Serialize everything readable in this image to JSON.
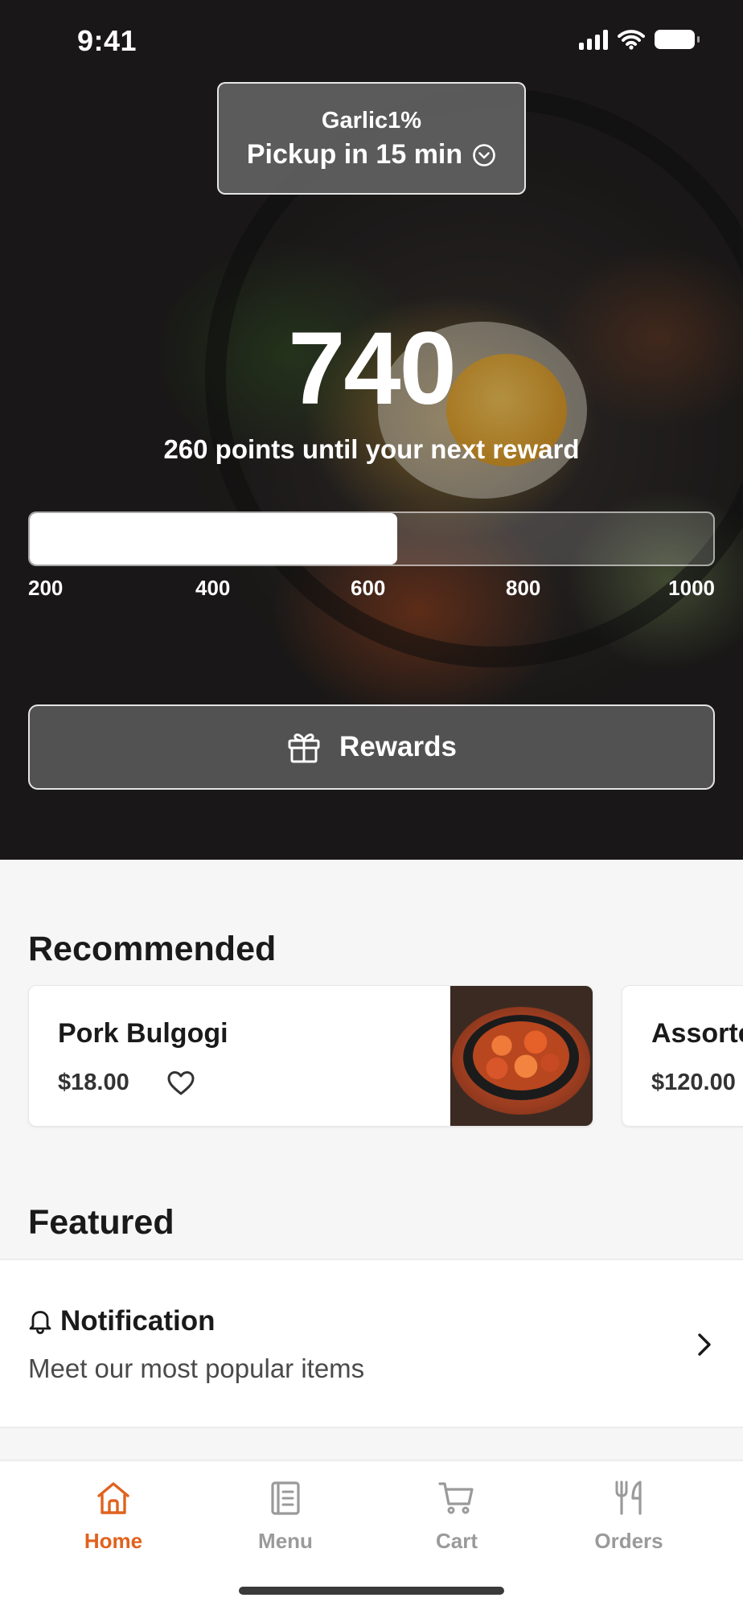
{
  "status_bar": {
    "time": "9:41"
  },
  "store": {
    "name": "Garlic1%",
    "pickup": "Pickup in 15 min"
  },
  "points": {
    "value": "740",
    "caption": "260 points until your next reward",
    "progress_fraction": 0.5375,
    "ticks": [
      "200",
      "400",
      "600",
      "800",
      "1000"
    ]
  },
  "rewards_button": {
    "label": "Rewards",
    "icon": "gift-icon"
  },
  "recommended": {
    "title": "Recommended",
    "items": [
      {
        "name": "Pork Bulgogi",
        "price": "$18.00",
        "favorite_icon": "heart-icon"
      },
      {
        "name": "Assorte",
        "price": "$120.00"
      }
    ]
  },
  "featured": {
    "title": "Featured",
    "notification": {
      "title": "Notification",
      "subtitle": "Meet our most popular items",
      "icon": "bell-icon"
    }
  },
  "tab_bar": {
    "tabs": [
      {
        "label": "Home",
        "icon": "home-icon",
        "active": true
      },
      {
        "label": "Menu",
        "icon": "menu-book-icon",
        "active": false
      },
      {
        "label": "Cart",
        "icon": "cart-icon",
        "active": false
      },
      {
        "label": "Orders",
        "icon": "utensils-icon",
        "active": false
      }
    ]
  },
  "colors": {
    "accent": "#e0621d",
    "inactive_tab": "#9a9a9a",
    "hero_bg": "#242221"
  }
}
